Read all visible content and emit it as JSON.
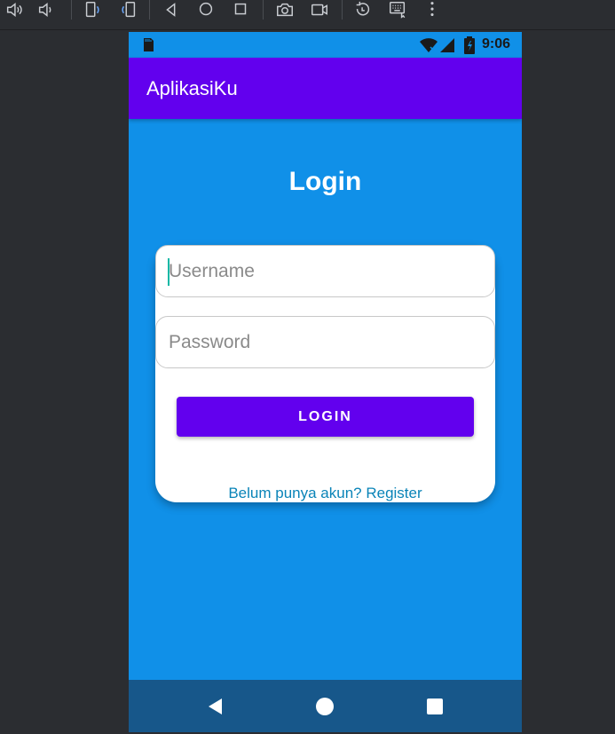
{
  "emulator_toolbar": {
    "icons": [
      "volume-up-icon",
      "volume-down-icon",
      "rotate-left-icon",
      "rotate-right-icon",
      "back-icon",
      "home-icon",
      "overview-icon",
      "screenshot-icon",
      "screen-record-icon",
      "replay-icon",
      "keyboard-icon",
      "more-icon"
    ]
  },
  "status_bar": {
    "time": "9:06"
  },
  "app_bar": {
    "title": "AplikasiKu"
  },
  "login": {
    "heading": "Login",
    "username_placeholder": "Username",
    "password_placeholder": "Password",
    "login_button": "LOGIN",
    "register_link": "Belum punya akun? Register"
  },
  "colors": {
    "background": "#1090e8",
    "app_bar": "#6200ee",
    "button": "#6200ee",
    "link": "#0a84b8",
    "nav_bar": "#17578a"
  }
}
